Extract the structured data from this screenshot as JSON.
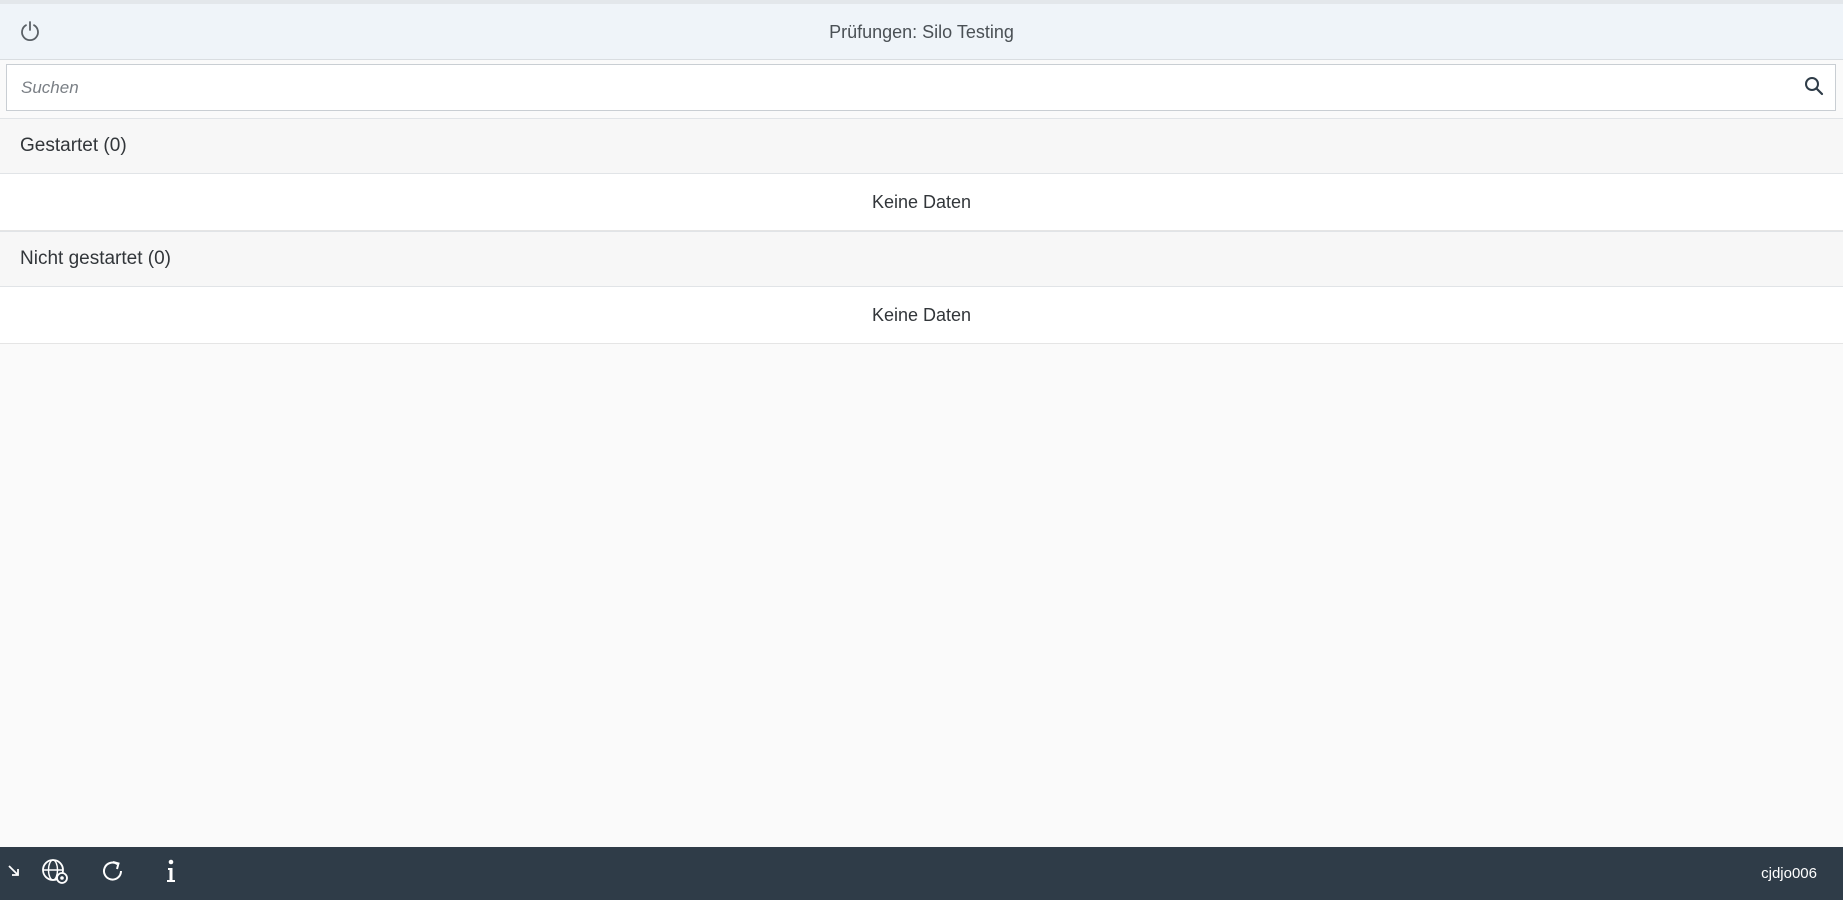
{
  "header": {
    "title": "Prüfungen: Silo Testing",
    "power_icon": "power-icon"
  },
  "search": {
    "placeholder": "Suchen",
    "value": "",
    "icon": "search-icon"
  },
  "groups": [
    {
      "label": "Gestartet (0)",
      "empty_text": "Keine Daten"
    },
    {
      "label": "Nicht gestartet (0)",
      "empty_text": "Keine Daten"
    }
  ],
  "footer": {
    "icons": [
      "expand-arrow-icon",
      "globe-settings-icon",
      "refresh-icon",
      "info-icon"
    ],
    "user": "cjdjo006"
  },
  "colors": {
    "header_bg": "#eff4f9",
    "footer_bg": "#2f3c48",
    "page_bg": "#fafafa"
  }
}
